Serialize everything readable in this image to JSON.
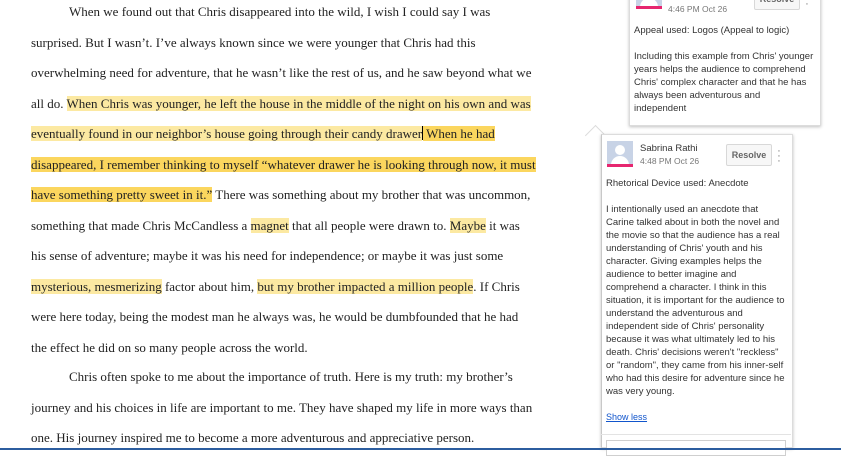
{
  "document": {
    "p1": {
      "a": "When we found out that Chris disappeared into the wild, I wish I could say I was surprised. But I wasn’t. I’ve always known since we were younger that Chris had this overwhelming need for adventure, that he wasn’t like the rest of us, and he saw beyond what we all do. ",
      "h1": "When Chris was younger, he left the house in the middle of the night on his own and was eventually found in our neighbor’s house going through their candy drawer",
      "h2": " When he had disappeared, I remember thinking to myself  “whatever drawer he is looking through now, it must have something pretty sweet in it.”",
      "b": " There was something about my brother that was uncommon, something that made Chris McCandless a ",
      "h3": "magnet",
      "c": " that all people were drawn to. ",
      "h4": "Maybe",
      "d": " it was his sense of adventure; maybe it was his need for independence; or maybe it was just some ",
      "h5": "mysterious, mesmerizing",
      "e": " factor about him, ",
      "h6": "but my brother impacted a million people",
      "f": ". If Chris were here today, being the modest man he always was, he would be dumbfounded that he had the effect he did on so many people across the world."
    },
    "p2": "Chris often spoke to me about the importance of truth. Here is my truth: my brother’s journey and his choices in life are important to me. They have shaped my life in more ways than one. His journey inspired me to become a more adventurous and appreciative person."
  },
  "comments": [
    {
      "time": "4:46 PM Oct 26",
      "resolve_label": "Resolve",
      "title": "Appeal used: Logos (Appeal to logic)",
      "body": "Including this example from Chris' younger years helps the audience to comprehend Chris' complex character and that he has always been adventurous and independent"
    },
    {
      "author": "Sabrina Rathi",
      "time": "4:48 PM Oct 26",
      "resolve_label": "Resolve",
      "title": "Rhetorical Device used: Anecdote",
      "body": "I intentionally used an anecdote that Carine talked about in both the novel and the movie so that the audience has a real understanding of Chris' youth and his character. Giving examples helps the audience to better imagine and comprehend a character. I think in this situation, it is important for the audience to understand the adventurous and independent side of Chris' personality because it was what ultimately led to his death. Chris' decisions weren't \"reckless\" or \"random\", they came from his inner-self who had this desire for adventure since he was very young.",
      "show_less": "Show less"
    }
  ],
  "colors": {
    "highlight": "#fce9a2",
    "highlight_active": "#fbd65e",
    "avatar_bar": "#e6266f",
    "link": "#1155cc",
    "bottom_line": "#2c5d9f"
  }
}
